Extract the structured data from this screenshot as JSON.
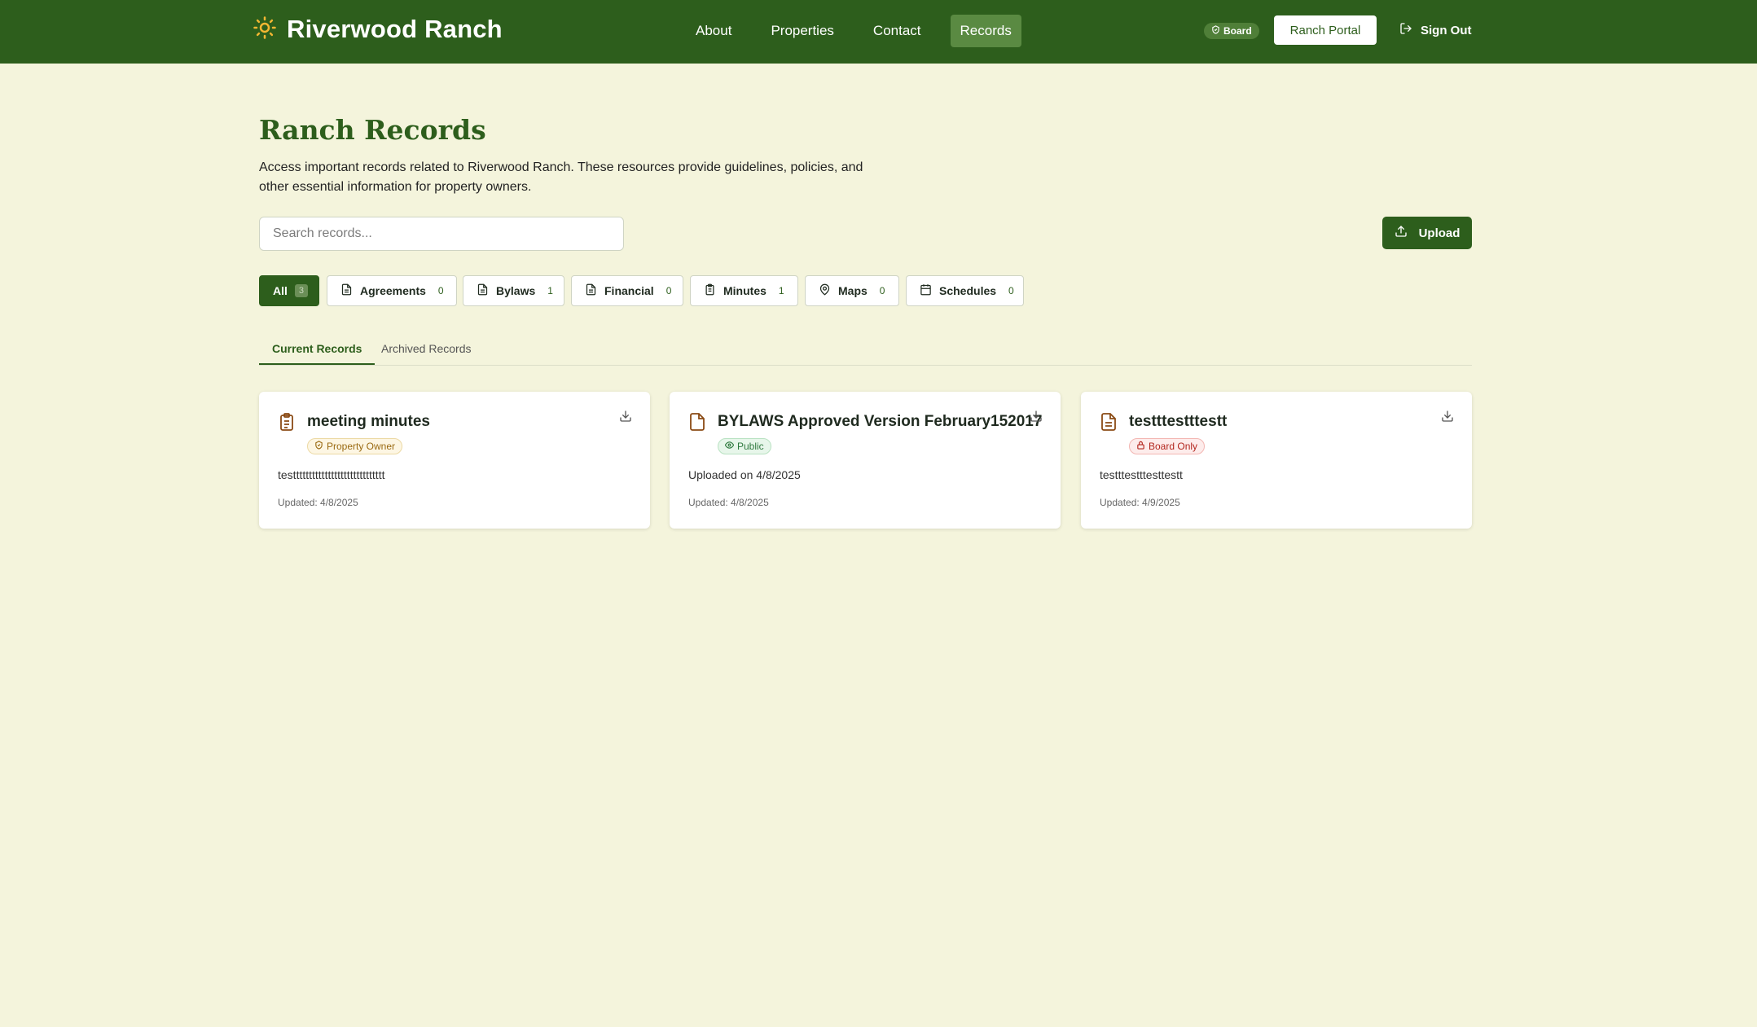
{
  "header": {
    "brand": "Riverwood Ranch",
    "nav": [
      "About",
      "Properties",
      "Contact",
      "Records"
    ],
    "board_badge": "Board",
    "portal_button": "Ranch Portal",
    "sign_out": "Sign Out"
  },
  "page": {
    "title": "Ranch Records",
    "description": "Access important records related to Riverwood Ranch. These resources provide guidelines, policies, and other essential information for property owners.",
    "search_placeholder": "Search records...",
    "upload_label": "Upload"
  },
  "filters": [
    {
      "label": "All",
      "count": "3",
      "icon": "none"
    },
    {
      "label": "Agreements",
      "count": "0",
      "icon": "file-text-icon"
    },
    {
      "label": "Bylaws",
      "count": "1",
      "icon": "file-text-icon"
    },
    {
      "label": "Financial",
      "count": "0",
      "icon": "file-text-icon"
    },
    {
      "label": "Minutes",
      "count": "1",
      "icon": "clipboard-icon"
    },
    {
      "label": "Maps",
      "count": "0",
      "icon": "map-pin-icon"
    },
    {
      "label": "Schedules",
      "count": "0",
      "icon": "calendar-icon"
    }
  ],
  "tabs": [
    "Current Records",
    "Archived Records"
  ],
  "records": [
    {
      "title": "meeting minutes",
      "badge": "Property Owner",
      "description": "testtttttttttttttttttttttttttttt",
      "updated": "Updated: 4/8/2025",
      "icon": "clipboard-icon"
    },
    {
      "title": "BYLAWS Approved Version February152017",
      "badge": "Public",
      "description": "Uploaded on 4/8/2025",
      "updated": "Updated: 4/8/2025",
      "icon": "file-icon"
    },
    {
      "title": "testttestttestt",
      "badge": "Board Only",
      "description": "testttestttesttestt",
      "updated": "Updated: 4/9/2025",
      "icon": "file-text-icon"
    }
  ],
  "colors": {
    "primary": "#2d5e1c",
    "background": "#f4f4dc",
    "accent_sun": "#f2b632"
  }
}
